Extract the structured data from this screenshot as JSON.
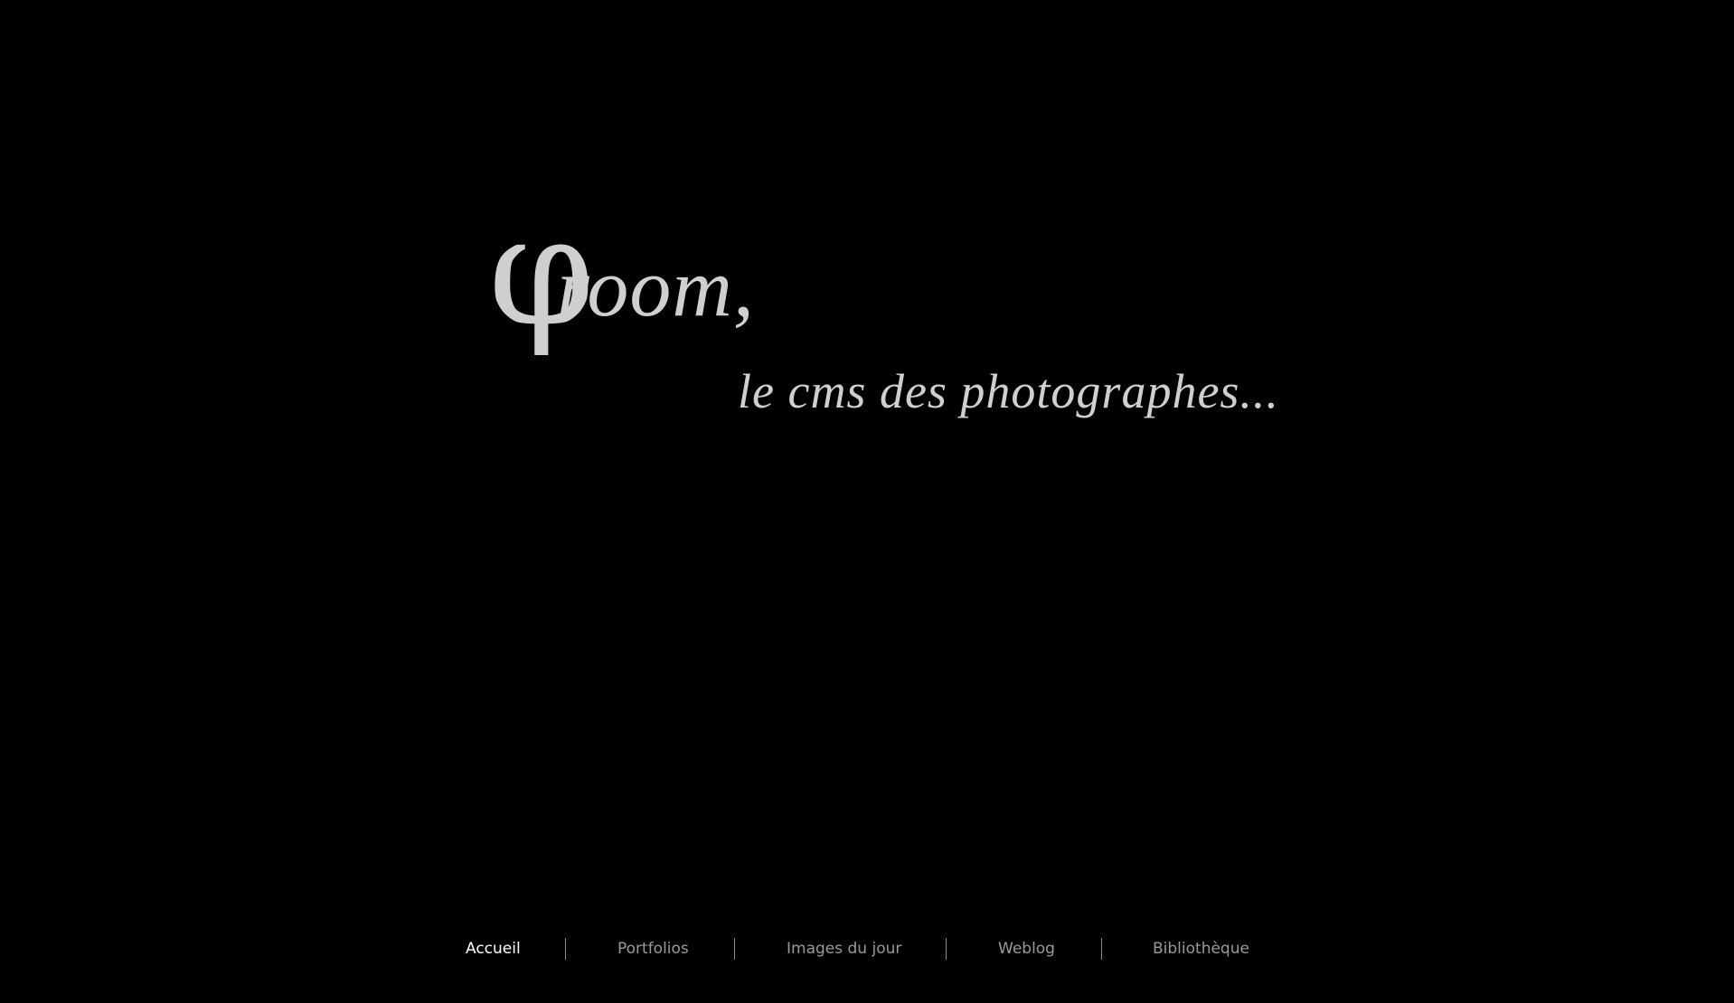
{
  "logo": {
    "symbol": "φ",
    "word": "room,",
    "tagline": "le cms des photographes..."
  },
  "nav": {
    "items": [
      {
        "label": "Accueil",
        "active": true
      },
      {
        "label": "Portfolios",
        "active": false
      },
      {
        "label": "Images du jour",
        "active": false
      },
      {
        "label": "Weblog",
        "active": false
      },
      {
        "label": "Bibliothèque",
        "active": false
      }
    ]
  },
  "colors": {
    "background": "#000000",
    "logo": "#cfcfcf",
    "nav_text": "#9a9a9a",
    "nav_active": "#ffffff",
    "divider": "#8a8a8a"
  }
}
